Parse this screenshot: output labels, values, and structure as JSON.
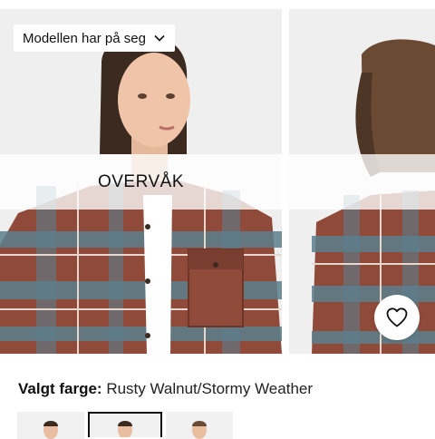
{
  "gallery": {
    "model_dropdown_label": "Modellen har på seg",
    "watch_label": "OVERVÅK"
  },
  "product": {
    "color_label": "Valgt farge:",
    "color_value": "Rusty Walnut/Stormy Weather"
  },
  "swatches": [
    {
      "name": "variant-1",
      "selected": false
    },
    {
      "name": "variant-2",
      "selected": true
    },
    {
      "name": "variant-3",
      "selected": false
    }
  ],
  "colors": {
    "shirt_rust": "#8f4a3a",
    "shirt_blue": "#5b7f8c",
    "background": "#efefef"
  }
}
